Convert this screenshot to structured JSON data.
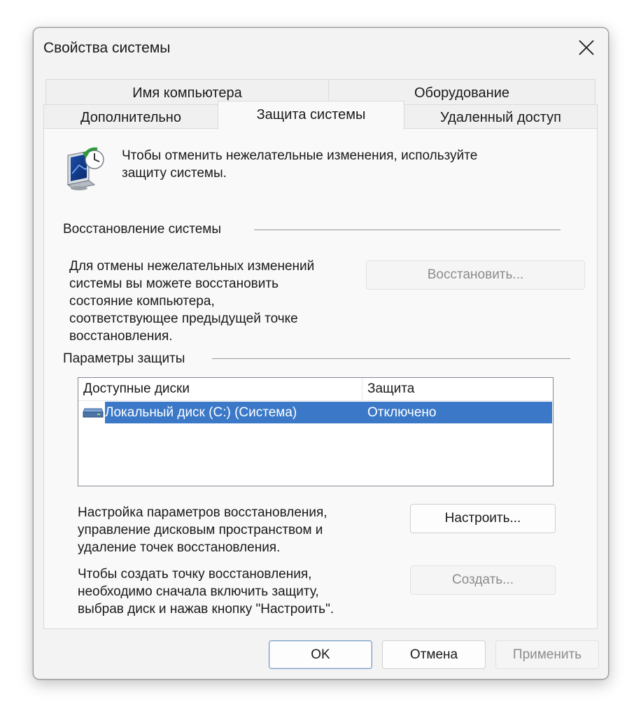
{
  "window": {
    "title": "Свойства системы"
  },
  "tabs": [
    {
      "label": "Имя компьютера"
    },
    {
      "label": "Оборудование"
    },
    {
      "label": "Дополнительно"
    },
    {
      "label": "Защита системы"
    },
    {
      "label": "Удаленный доступ"
    }
  ],
  "intro": {
    "text": "Чтобы отменить нежелательные изменения, используйте\nзащиту системы."
  },
  "restore": {
    "heading": "Восстановление системы",
    "text": "Для отмены нежелательных изменений\nсистемы вы можете восстановить\nсостояние компьютера,\nсоответствующее предыдущей точке\nвосстановления.",
    "button": "Восстановить..."
  },
  "protection": {
    "heading": "Параметры защиты",
    "columns": [
      "Доступные диски",
      "Защита"
    ],
    "rows": [
      {
        "drive": "Локальный диск (C:) (Система)",
        "status": "Отключено"
      }
    ],
    "configure_text": "Настройка параметров восстановления,\nуправление дисковым пространством и\nудаление точек восстановления.",
    "configure_button": "Настроить...",
    "create_text": "Чтобы создать точку восстановления,\nнеобходимо сначала включить защиту,\nвыбрав диск и нажав кнопку \"Настроить\".",
    "create_button": "Создать..."
  },
  "footer": {
    "ok": "OK",
    "cancel": "Отмена",
    "apply": "Применить"
  },
  "colors": {
    "selection": "#3b79c8",
    "dialog_bg": "#f3f3f3",
    "panel_bg": "#f9f9f9"
  },
  "icons": [
    "system-restore-icon",
    "close-icon",
    "drive-icon"
  ]
}
